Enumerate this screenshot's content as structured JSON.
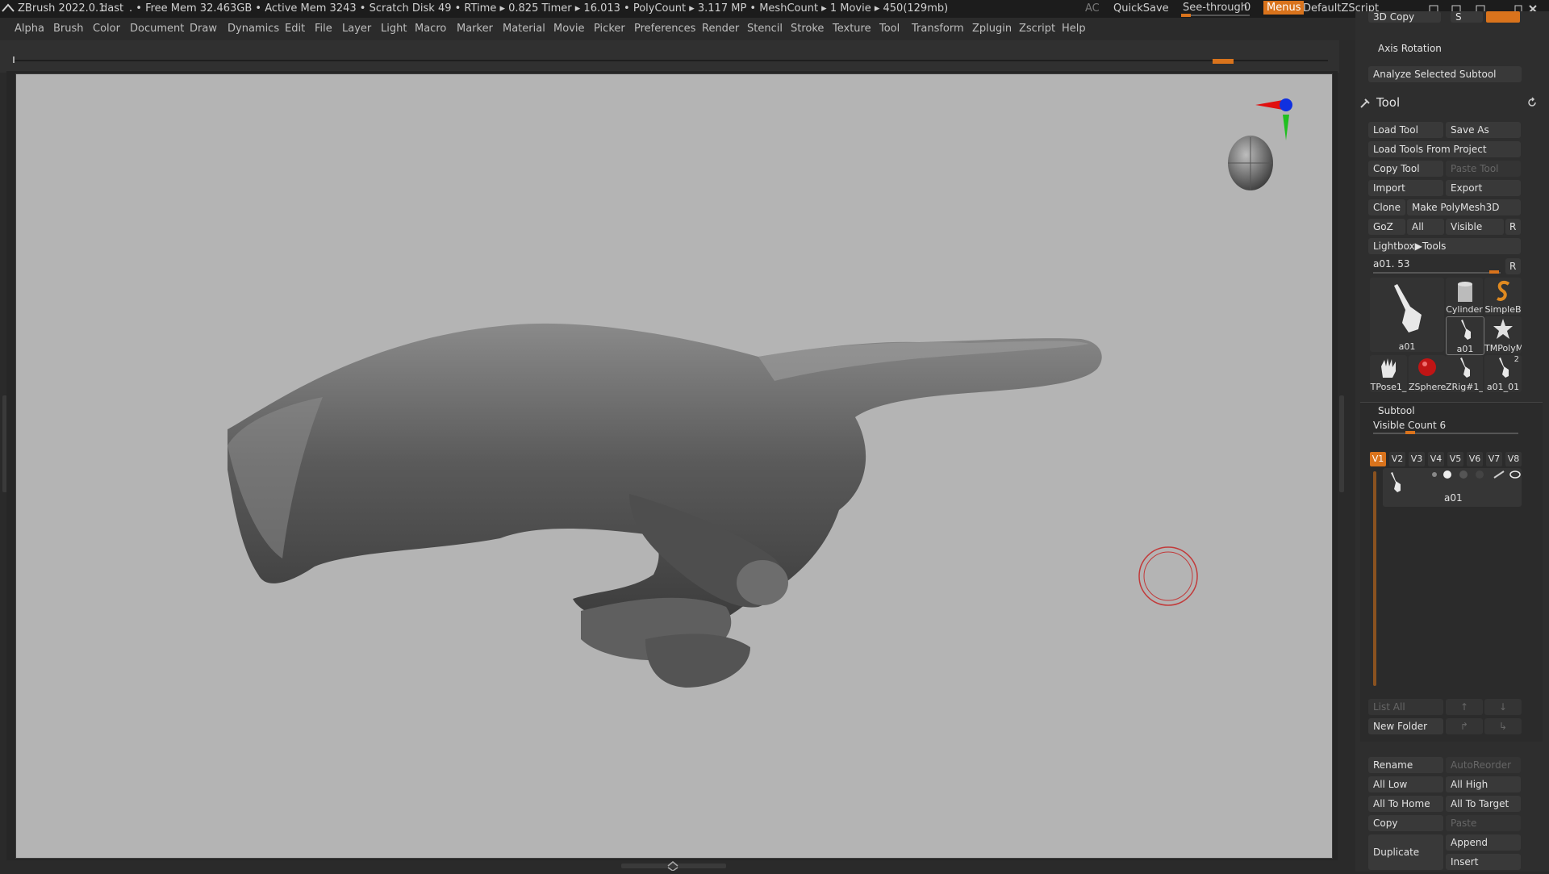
{
  "titlebar": {
    "app": "ZBrush 2022.0.1",
    "doc": "dast",
    "stats": ". • Free Mem 32.463GB • Active Mem 3243 • Scratch Disk 49 • RTime ▸ 0.825 Timer ▸ 16.013 • PolyCount ▸ 3.117 MP • MeshCount ▸ 1 Movie ▸ 450(129mb)",
    "ac": "AC",
    "quicksave": "QuickSave",
    "see_through_label": "See-through",
    "see_through_value": "0",
    "see_through_level": 0,
    "menus": "Menus",
    "script": "DefaultZScript"
  },
  "menubar": [
    "Alpha",
    "Brush",
    "Color",
    "Document",
    "Draw",
    "Dynamics",
    "Edit",
    "File",
    "Layer",
    "Light",
    "Macro",
    "Marker",
    "Material",
    "Movie",
    "Picker",
    "Preferences",
    "Render",
    "Stencil",
    "Stroke",
    "Texture",
    "Tool",
    "Transform",
    "Zplugin",
    "Zscript",
    "Help"
  ],
  "panel": {
    "top_partial": "3D Copy",
    "top_partial_value": "S",
    "axis_rotation": "Axis Rotation",
    "analyze": "Analyze Selected Subtool",
    "tool_title": "Tool",
    "load_tool": "Load Tool",
    "save_as": "Save As",
    "load_from_project": "Load Tools From Project",
    "copy_tool": "Copy Tool",
    "paste_tool": "Paste Tool",
    "import": "Import",
    "export": "Export",
    "clone": "Clone",
    "make_polymesh": "Make PolyMesh3D",
    "goz": "GoZ",
    "all": "All",
    "visible": "Visible",
    "r": "R",
    "lightbox": "Lightbox▶Tools",
    "tool_slider": "a01. 53",
    "thumbs": [
      {
        "cap": "a01",
        "icon": "hand-pointing-icon"
      },
      {
        "cap": "Cylinder",
        "icon": "cylinder-icon"
      },
      {
        "cap": "SimpleB",
        "icon": "simple-brush-icon"
      },
      {
        "cap": "a01",
        "icon": "hand-pointing-icon"
      },
      {
        "cap": "TMPolyM",
        "icon": "star-icon"
      },
      {
        "cap": "TPose1_",
        "icon": "hand-open-icon"
      },
      {
        "cap": "ZSphere",
        "icon": "zsphere-icon"
      },
      {
        "cap": "ZRig#1_",
        "icon": "hand-pointing-icon"
      },
      {
        "cap": "a01_01",
        "icon": "hand-pointing-icon",
        "badge": "2"
      }
    ],
    "subtool_title": "Subtool",
    "visible_count": "Visible Count 6",
    "visible_count_level": 0.25,
    "vsets": [
      "V1",
      "V2",
      "V3",
      "V4",
      "V5",
      "V6",
      "V7",
      "V8"
    ],
    "subtool_item": "a01",
    "list_all": "List All",
    "new_folder": "New Folder",
    "rename": "Rename",
    "autoreorder": "AutoReorder",
    "all_low": "All Low",
    "all_high": "All High",
    "all_to_home": "All To Home",
    "all_to_target": "All To Target",
    "copy": "Copy",
    "paste": "Paste",
    "duplicate": "Duplicate",
    "append": "Append",
    "insert": "Insert"
  },
  "colors": {
    "accent": "#d9731c",
    "canvas": "#b4b4b4",
    "panel": "#2e2e2e"
  }
}
